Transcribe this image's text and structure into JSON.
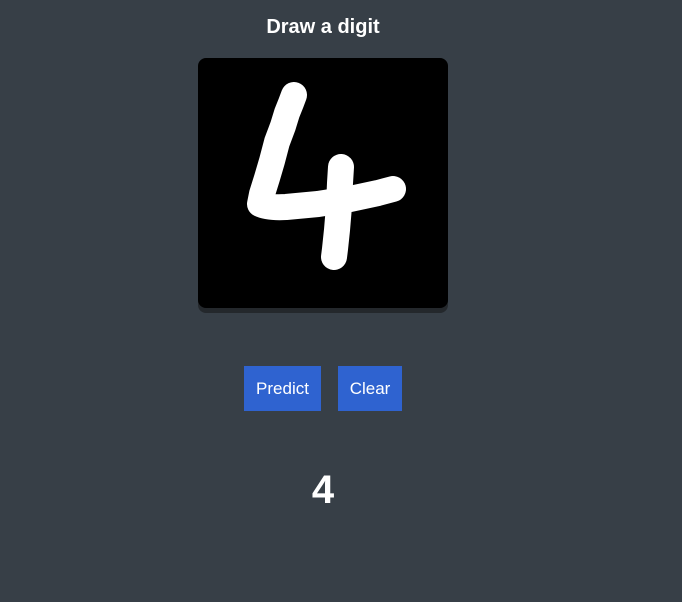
{
  "page": {
    "title": "Draw a digit"
  },
  "canvas": {
    "content": "handwritten digit 4",
    "background": "#000000",
    "stroke_color": "#ffffff"
  },
  "buttons": {
    "predict_label": "Predict",
    "clear_label": "Clear",
    "color": "#2f63d0"
  },
  "result": {
    "prediction": "4"
  }
}
